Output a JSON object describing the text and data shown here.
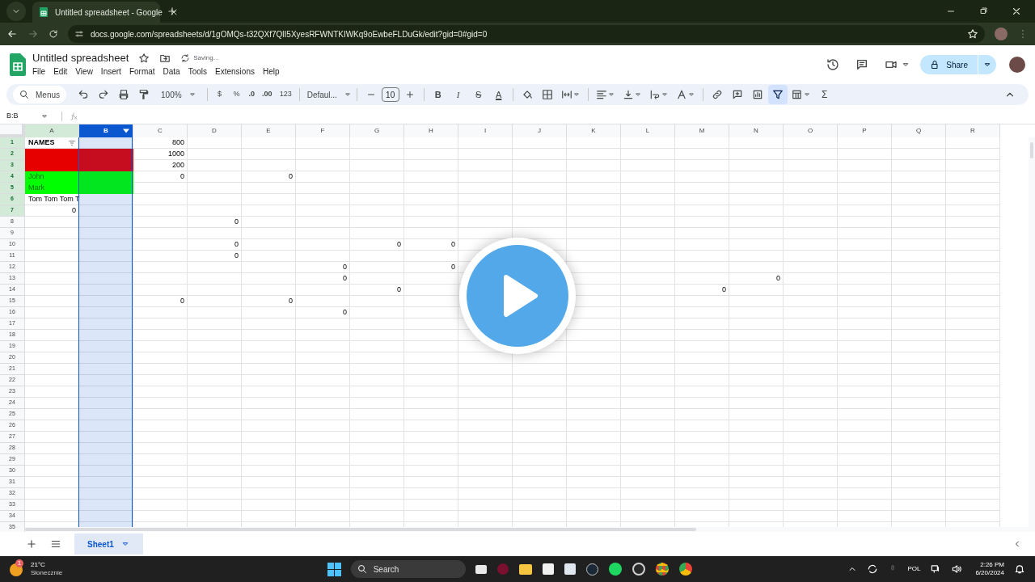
{
  "browser": {
    "tab_title": "Untitled spreadsheet - Google",
    "url": "docs.google.com/spreadsheets/d/1gOMQs-t32QXf7QlI5XyesRFWNTKIWKq9oEwbeFLDuGk/edit?gid=0#gid=0"
  },
  "document": {
    "title": "Untitled spreadsheet",
    "status": "Saving...",
    "share_label": "Share"
  },
  "menu": [
    "File",
    "Edit",
    "View",
    "Insert",
    "Format",
    "Data",
    "Tools",
    "Extensions",
    "Help"
  ],
  "toolbar": {
    "search_label": "Menus",
    "zoom": "100%",
    "currency": "$",
    "percent": "%",
    "decrease_decimals": ".0",
    "increase_decimals": ".00",
    "number_format": "123",
    "font": "Defaul...",
    "font_size": "10",
    "bold": "B",
    "italic": "I",
    "strikethrough": "S",
    "text_color": "A",
    "functions": "Σ",
    "filter_active": true
  },
  "formula_bar": {
    "name_box": "B:B"
  },
  "grid": {
    "columns": [
      {
        "label": "A",
        "selected": false
      },
      {
        "label": "B",
        "selected": true
      },
      {
        "label": "C",
        "selected": false
      },
      {
        "label": "D",
        "selected": false
      },
      {
        "label": "E",
        "selected": false
      },
      {
        "label": "F",
        "selected": false
      },
      {
        "label": "G",
        "selected": false
      },
      {
        "label": "H",
        "selected": false
      },
      {
        "label": "I",
        "selected": false
      },
      {
        "label": "J",
        "selected": false
      },
      {
        "label": "K",
        "selected": false
      },
      {
        "label": "L",
        "selected": false
      },
      {
        "label": "M",
        "selected": false
      },
      {
        "label": "N",
        "selected": false
      },
      {
        "label": "O",
        "selected": false
      },
      {
        "label": "P",
        "selected": false
      },
      {
        "label": "Q",
        "selected": false
      },
      {
        "label": "R",
        "selected": false
      }
    ],
    "rows": [
      {
        "number": "1",
        "in_filter": true,
        "cells": [
          {
            "text": "NAMES",
            "kind": "header",
            "filter": true
          },
          null,
          {
            "text": "800",
            "kind": "number"
          }
        ]
      },
      {
        "number": "2",
        "in_filter": true,
        "color": "#e60000",
        "cells": [
          null,
          null,
          {
            "text": "1000",
            "kind": "number"
          }
        ]
      },
      {
        "number": "3",
        "in_filter": true,
        "color": "#e60000",
        "cells": [
          null,
          null,
          {
            "text": "200",
            "kind": "number"
          }
        ]
      },
      {
        "number": "4",
        "in_filter": true,
        "color": "#00ff00",
        "cells": [
          {
            "text": "John",
            "kind": "text"
          },
          null,
          {
            "text": "0",
            "kind": "number"
          },
          null,
          {
            "text": "0",
            "kind": "number"
          }
        ]
      },
      {
        "number": "5",
        "in_filter": true,
        "color": "#00ff00",
        "cells": [
          {
            "text": "Mark",
            "kind": "text"
          }
        ]
      },
      {
        "number": "6",
        "in_filter": true,
        "cells": [
          {
            "text": "Tom Tom Tom T",
            "kind": "text"
          }
        ]
      },
      {
        "number": "7",
        "in_filter": true,
        "cells": [
          {
            "text": "0",
            "kind": "number"
          }
        ]
      },
      {
        "number": "8",
        "in_filter": false,
        "cells": [
          null,
          null,
          null,
          {
            "text": "0",
            "kind": "number"
          }
        ]
      },
      {
        "number": "9",
        "in_filter": false
      },
      {
        "number": "10",
        "in_filter": false,
        "cells": [
          null,
          null,
          null,
          {
            "text": "0",
            "kind": "number"
          },
          null,
          null,
          {
            "text": "0",
            "kind": "number"
          },
          {
            "text": "0",
            "kind": "number"
          }
        ]
      },
      {
        "number": "11",
        "in_filter": false,
        "cells": [
          null,
          null,
          null,
          {
            "text": "0",
            "kind": "number"
          }
        ]
      },
      {
        "number": "12",
        "in_filter": false,
        "cells": [
          null,
          null,
          null,
          null,
          null,
          {
            "text": "0",
            "kind": "number"
          },
          null,
          {
            "text": "0",
            "kind": "number"
          }
        ]
      },
      {
        "number": "13",
        "in_filter": false,
        "cells": [
          null,
          null,
          null,
          null,
          null,
          {
            "text": "0",
            "kind": "number"
          },
          null,
          null,
          null,
          null,
          null,
          null,
          null,
          {
            "text": "0",
            "kind": "number"
          }
        ]
      },
      {
        "number": "14",
        "in_filter": false,
        "cells": [
          null,
          null,
          null,
          null,
          null,
          null,
          {
            "text": "0",
            "kind": "number"
          },
          null,
          null,
          null,
          null,
          null,
          {
            "text": "0",
            "kind": "number"
          }
        ]
      },
      {
        "number": "15",
        "in_filter": false,
        "cells": [
          null,
          null,
          {
            "text": "0",
            "kind": "number"
          },
          null,
          {
            "text": "0",
            "kind": "number"
          }
        ]
      },
      {
        "number": "16",
        "in_filter": false,
        "cells": [
          null,
          null,
          null,
          null,
          null,
          {
            "text": "0",
            "kind": "number"
          }
        ]
      },
      {
        "number": "17",
        "in_filter": false
      },
      {
        "number": "18",
        "in_filter": false
      },
      {
        "number": "19",
        "in_filter": false
      },
      {
        "number": "20",
        "in_filter": false
      },
      {
        "number": "21",
        "in_filter": false
      },
      {
        "number": "22",
        "in_filter": false
      },
      {
        "number": "23",
        "in_filter": false
      },
      {
        "number": "24",
        "in_filter": false
      },
      {
        "number": "25",
        "in_filter": false
      },
      {
        "number": "26",
        "in_filter": false
      },
      {
        "number": "27",
        "in_filter": false
      },
      {
        "number": "28",
        "in_filter": false
      },
      {
        "number": "29",
        "in_filter": false
      },
      {
        "number": "30",
        "in_filter": false
      },
      {
        "number": "31",
        "in_filter": false
      },
      {
        "number": "32",
        "in_filter": false
      },
      {
        "number": "33",
        "in_filter": false
      },
      {
        "number": "34",
        "in_filter": false
      },
      {
        "number": "35",
        "in_filter": false
      }
    ]
  },
  "sheets": [
    {
      "label": "Sheet1",
      "selected": true
    }
  ],
  "taskbar": {
    "temperature": "21°C",
    "weather": "Słonecznie",
    "notification_badge": "1",
    "search_placeholder": "Search",
    "language": "POL",
    "time": "2:26 PM",
    "date": "6/20/2024"
  }
}
